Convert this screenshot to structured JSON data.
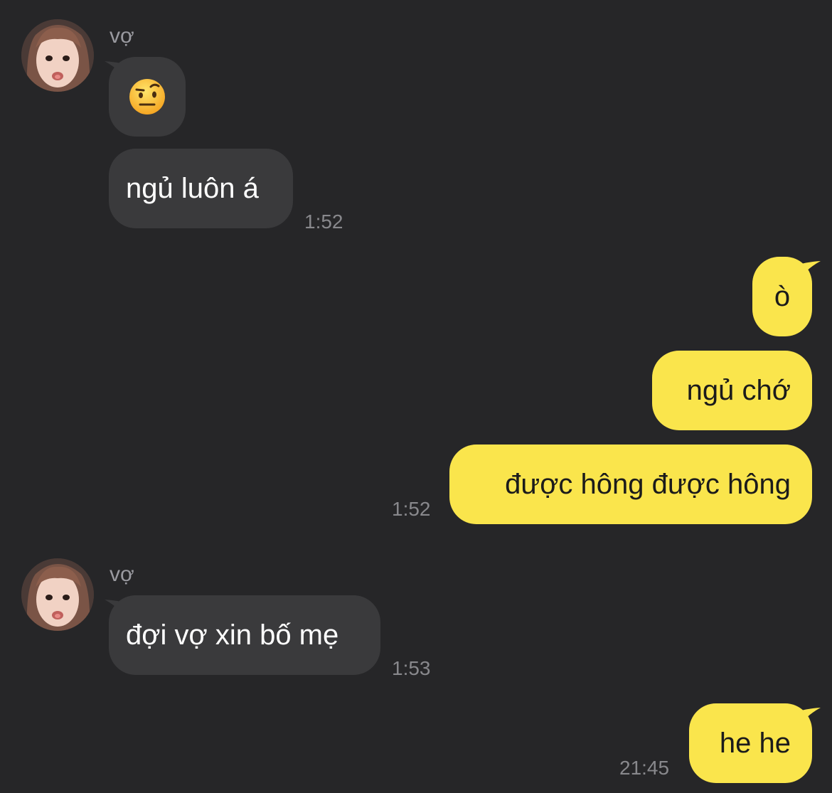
{
  "chat": {
    "groups": [
      {
        "sender": "vợ",
        "messages": [
          {
            "type": "emoji",
            "emoji_name": "face-with-raised-eyebrow"
          },
          {
            "type": "text",
            "text": "ngủ luôn á"
          }
        ],
        "time": "1:52"
      },
      {
        "sender": "me",
        "messages": [
          {
            "type": "text",
            "text": "ò"
          },
          {
            "type": "text",
            "text": "ngủ chớ"
          },
          {
            "type": "text",
            "text": "được hông được hông"
          }
        ],
        "time": "1:52"
      },
      {
        "sender": "vợ",
        "messages": [
          {
            "type": "text",
            "text": "đợi vợ xin bố mẹ"
          }
        ],
        "time": "1:53"
      },
      {
        "sender": "me",
        "messages": [
          {
            "type": "text",
            "text": "he he"
          }
        ],
        "time": "21:45"
      }
    ]
  },
  "colors": {
    "background": "#262628",
    "incoming_bubble": "#3a3a3c",
    "outgoing_bubble": "#fae54c",
    "timestamp": "#88888c",
    "sender_name": "#9a9aa0"
  }
}
